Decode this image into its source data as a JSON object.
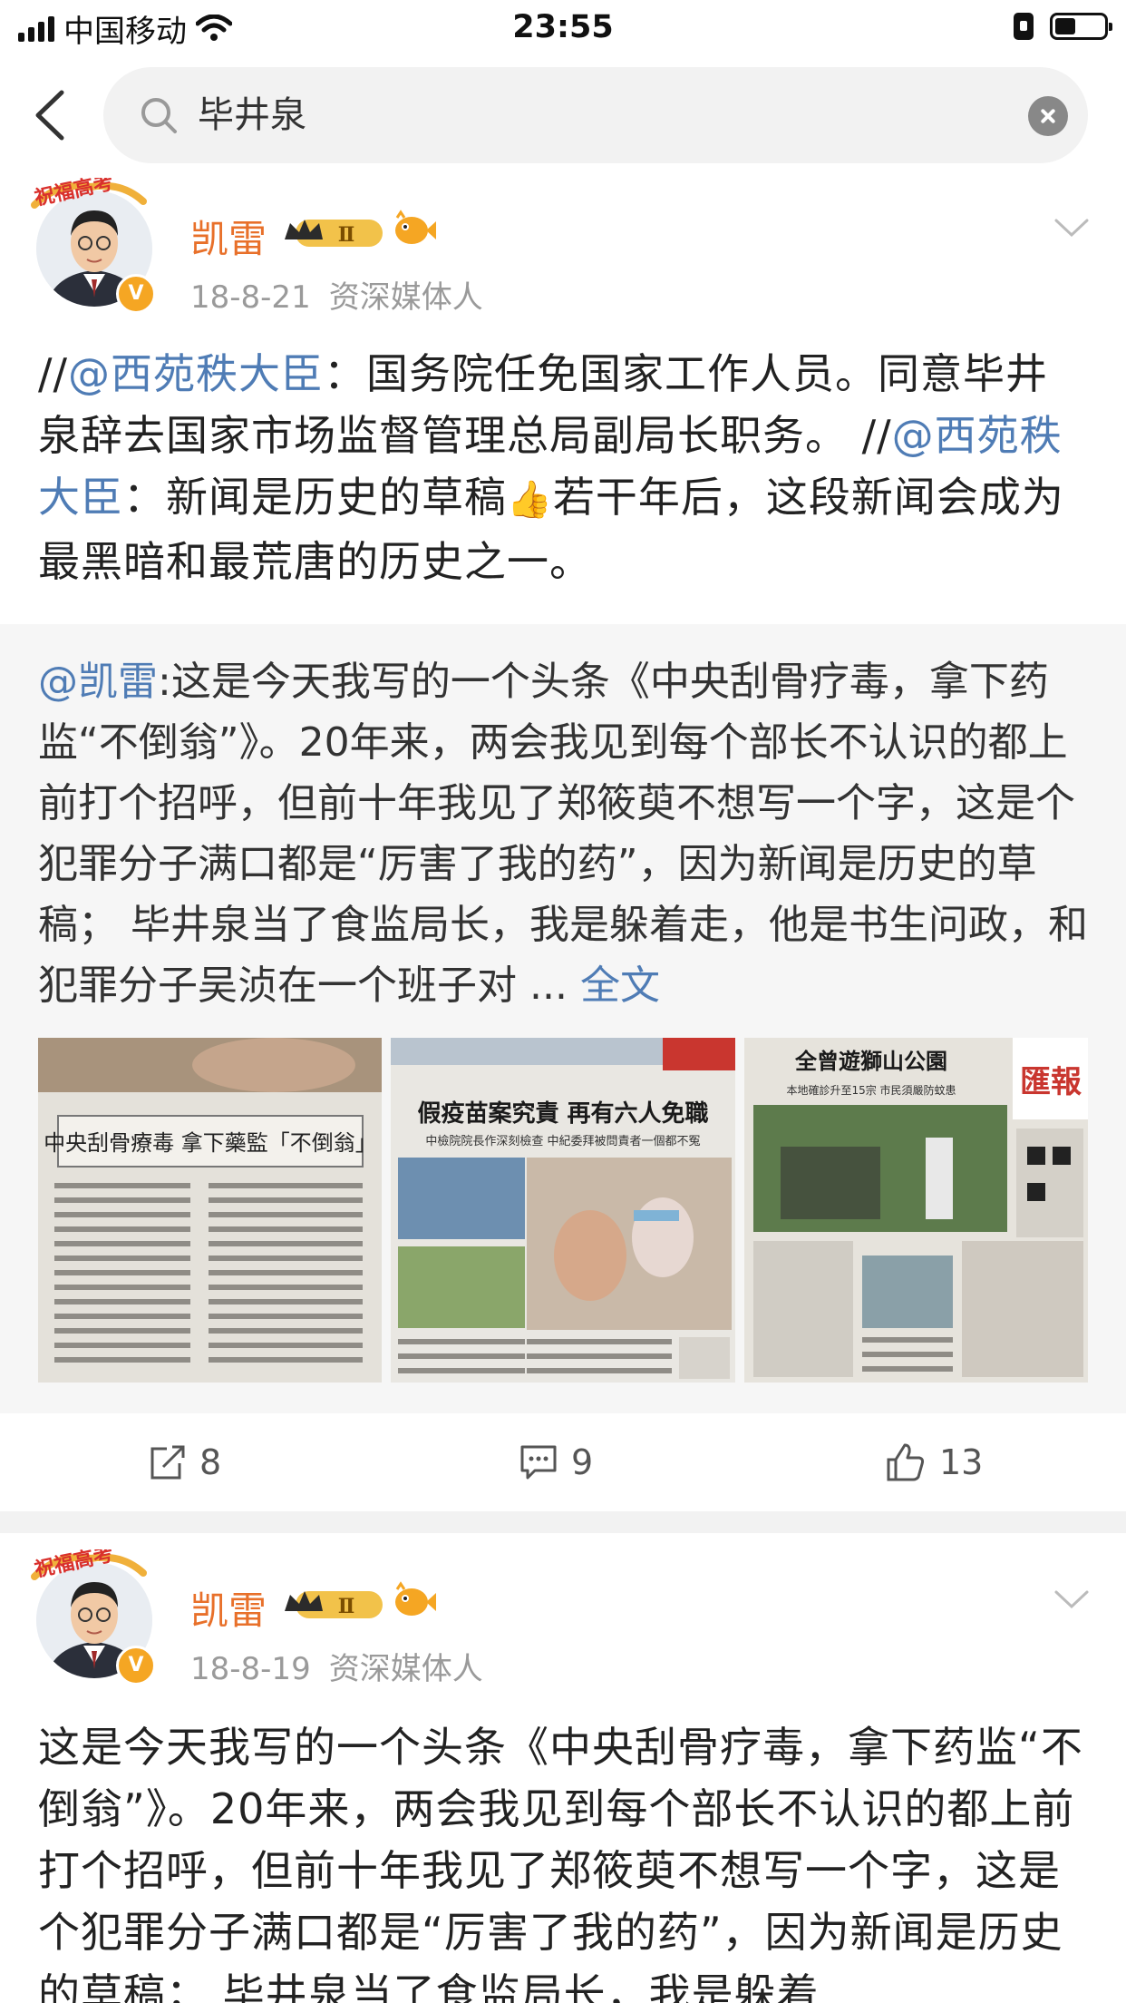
{
  "status_bar": {
    "carrier": "中国移动",
    "time": "23:55"
  },
  "search": {
    "query": "毕井泉"
  },
  "posts": [
    {
      "avatar_banner": "祝福高考",
      "user": "凯雷",
      "member_level": "Ⅱ",
      "date": "18-8-21",
      "source": "资深媒体人",
      "text": {
        "p1": "//",
        "m1": "@西苑秩大臣",
        "p2": "：国务院任免国家工作人员。同意毕井泉辞去国家市场监督管理总局副局长职务。 //",
        "m2": "@西苑秩大臣",
        "p3": "：新闻是历史的草稿",
        "p4": "若干年后，这段新闻会成为最黑暗和最荒唐的历史之一。"
      },
      "retweet": {
        "mention": "@凯雷",
        "text": ":这是今天我写的一个头条《中央刮骨疗毒，拿下药监“不倒翁”》。20年来，两会我见到每个部长不认识的都上前打个招呼，但前十年我见了郑筱萸不想写一个字，这是个犯罪分子满口都是“厉害了我的药”，因为新闻是历史的草稿； 毕井泉当了食监局长，我是躲着走，他是书生问政，和犯罪分子吴浈在一个班子对 ...",
        "more": "全文",
        "photos": [
          {
            "headline": "中央刮骨療毒 拿下藥監「不倒翁」"
          },
          {
            "headline": "假疫苗案究責 再有六人免職",
            "sub": "中檢院院長作深刻檢查 中紀委拜被問責者一個都不冤"
          },
          {
            "headline": "全曾遊獅山公園",
            "masthead": "匯報",
            "sub": "本地確診升至15宗 市民須嚴防蚊患"
          }
        ]
      },
      "actions": {
        "repost": "8",
        "comment": "9",
        "like": "13"
      }
    },
    {
      "avatar_banner": "祝福高考",
      "user": "凯雷",
      "member_level": "Ⅱ",
      "date": "18-8-19",
      "source": "资深媒体人",
      "text": "这是今天我写的一个头条《中央刮骨疗毒，拿下药监“不倒翁”》。20年来，两会我见到每个部长不认识的都上前打个招呼，但前十年我见了郑筱萸不想写一个字，这是个犯罪分子满口都是“厉害了我的药”，因为新闻是历史的草稿； 毕井泉当了食监局长，我是躲着"
    }
  ]
}
